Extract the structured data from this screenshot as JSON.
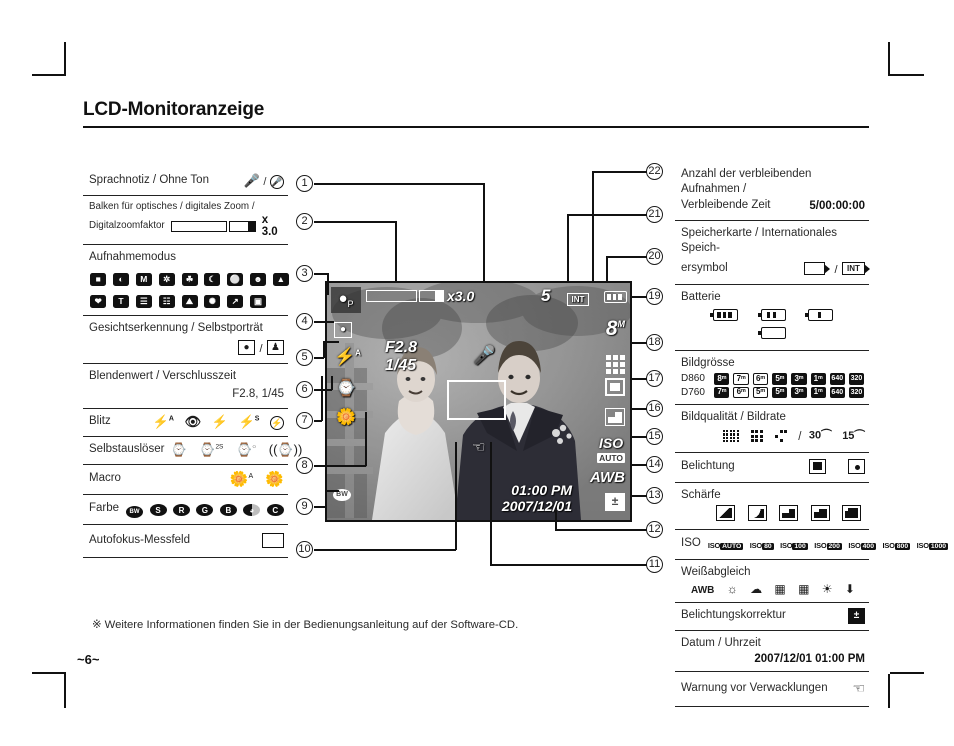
{
  "page": {
    "title": "LCD-Monitoranzeige",
    "footnote": "※ Weitere Informationen finden Sie in der Bedienungsanleitung auf der Software-CD.",
    "page_number": "~6~"
  },
  "left_column": [
    {
      "no": "1",
      "label": "Sprachnotiz / Ohne Ton",
      "icons": "mic / mic-muted"
    },
    {
      "no": "2",
      "label": "Balken für optisches / digitales Zoom /",
      "label2": "Digitalzoomfaktor",
      "value": "x 3.0"
    },
    {
      "no": "3",
      "label": "Aufnahmemodus",
      "modes_row1": [
        "●",
        "◐",
        "M",
        "✲",
        "✿",
        "☾",
        "⊘",
        "☻",
        "▲"
      ],
      "modes_row2": [
        "❤",
        "T",
        "☲",
        "☗",
        "⛰",
        "☀",
        "↗",
        "☂"
      ]
    },
    {
      "no": "4",
      "label": "Gesichtserkennung / Selbstporträt",
      "icons": "face-detect / self-portrait"
    },
    {
      "no": "5",
      "label": "Blendenwert / Verschlusszeit",
      "value": "F2.8, 1/45"
    },
    {
      "no": "6",
      "label": "Blitz",
      "icons": "flash-auto / red-eye / flash-fill / slow-sync / flash-off"
    },
    {
      "no": "7",
      "label": "Selbstauslöser",
      "icons": "timer-10s / timer-2s / timer-double / motion-timer"
    },
    {
      "no": "8",
      "label": "Macro",
      "icons": "auto-macro / macro"
    },
    {
      "no": "9",
      "label": "Farbe",
      "icons": "BW / S / R / G / B / half / custom"
    },
    {
      "no": "10",
      "label": "Autofokus-Messfeld",
      "icons": "af-frame"
    }
  ],
  "right_column": [
    {
      "no": "22",
      "label": "Anzahl der verbleibenden Aufnahmen /",
      "label2": "Verbleibende Zeit",
      "value": "5/00:00:00"
    },
    {
      "no": "21",
      "label": "Speicherkarte / Internationales Speich-",
      "label2": "ersymbol",
      "icons": "card / INT"
    },
    {
      "no": "20",
      "label": "Batterie",
      "icons": "battery-full / battery-mid / battery-low / battery-empty"
    },
    {
      "no": "19",
      "label": "Bildgrösse",
      "rows": [
        {
          "model": "D860",
          "sizes": [
            "8ᴹ",
            "7ᴹ",
            "6ᴹ",
            "5ᴹ",
            "3ᴹ",
            "1ᴹ",
            "640",
            "320"
          ]
        },
        {
          "model": "D760",
          "sizes": [
            "7ᴹ",
            "6ᴹ",
            "5ᴹ",
            "5ᴹ",
            "3ᴹ",
            "1ᴹ",
            "640",
            "320"
          ]
        }
      ]
    },
    {
      "no": "18",
      "label": "Bildqualität / Bildrate",
      "icons": "superfine / fine / normal / 30fps / 15fps"
    },
    {
      "no": "17",
      "label": "Belichtung",
      "icons": "multi-metering / spot-metering"
    },
    {
      "no": "16",
      "label": "Schärfe",
      "icons": "sharp-1 / sharp-2 / sharp-3 / sharp-4 / sharp-5"
    },
    {
      "no": "15",
      "label": "ISO",
      "iso_values": [
        "AUTO",
        "80",
        "100",
        "200",
        "400",
        "800",
        "1000"
      ]
    },
    {
      "no": "14",
      "label": "Weißabgleich",
      "icons": "AWB / daylight / cloudy / fluorescent-h / fluorescent-l / tungsten / custom"
    },
    {
      "no": "13",
      "label": "Belichtungskorrektur",
      "icons": "ev-compensation"
    },
    {
      "no": "12",
      "label": "Datum / Uhrzeit",
      "value": "2007/12/01  01:00 PM"
    },
    {
      "no": "11",
      "label": "Warnung vor Verwacklungen",
      "icons": "shake-warning"
    }
  ],
  "lcd": {
    "mode_icon": "program-mode",
    "zoom_factor": "x3.0",
    "remaining_shots": "5",
    "memory": "INT",
    "battery": "battery-full",
    "resolution": "8",
    "resolution_unit": "M",
    "quality": "superfine",
    "metering": "multi-metering",
    "sharpness": "sharp-normal",
    "iso_label": "ISO",
    "iso_value": "AUTO",
    "white_balance": "AWB",
    "ev": "ev-compensation",
    "aperture": "F2.8",
    "shutter": "1/45",
    "voice_memo": "mic",
    "shake_warning": "shake-icon",
    "face_detect": "face-detect",
    "flash": "flash-auto",
    "self_timer": "timer",
    "macro": "macro",
    "color": "color-bw",
    "af_frame": "af-frame",
    "time": "01:00 PM",
    "date": "2007/12/01"
  }
}
